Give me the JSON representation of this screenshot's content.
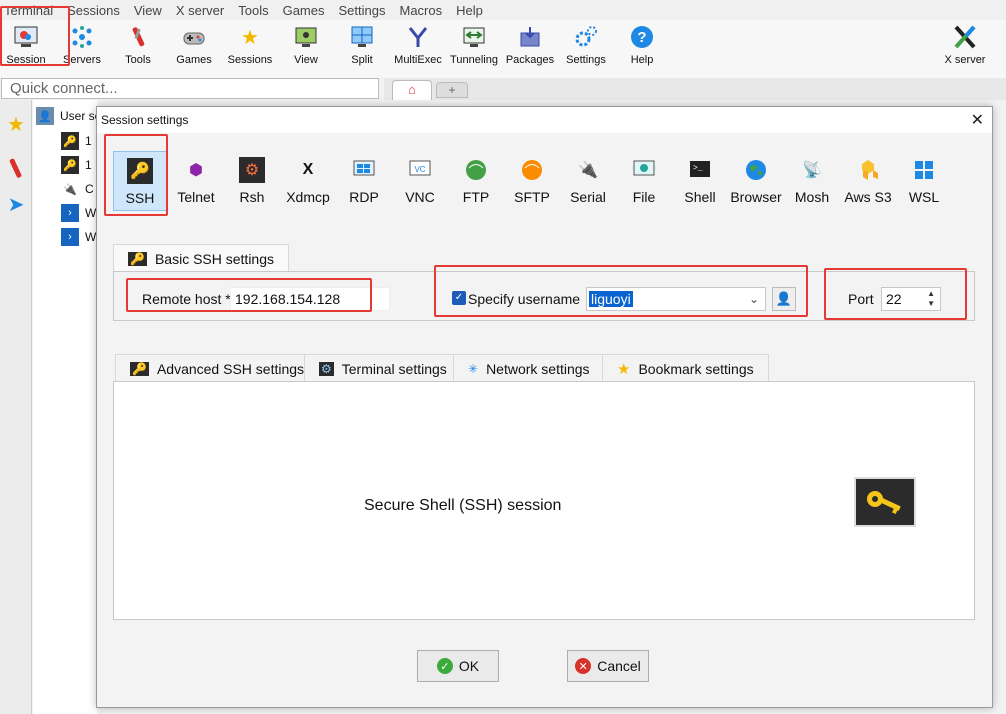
{
  "menu": [
    "Terminal",
    "Sessions",
    "View",
    "X server",
    "Tools",
    "Games",
    "Settings",
    "Macros",
    "Help"
  ],
  "toolbar": {
    "buttons": [
      {
        "label": "Session",
        "icon": "session-icon"
      },
      {
        "label": "Servers",
        "icon": "servers-icon"
      },
      {
        "label": "Tools",
        "icon": "tools-icon"
      },
      {
        "label": "Games",
        "icon": "games-icon"
      },
      {
        "label": "Sessions",
        "icon": "star-icon"
      },
      {
        "label": "View",
        "icon": "view-icon"
      },
      {
        "label": "Split",
        "icon": "split-icon"
      },
      {
        "label": "MultiExec",
        "icon": "multiexec-icon"
      },
      {
        "label": "Tunneling",
        "icon": "tunneling-icon"
      },
      {
        "label": "Packages",
        "icon": "packages-icon"
      },
      {
        "label": "Settings",
        "icon": "settings-icon"
      },
      {
        "label": "Help",
        "icon": "help-icon"
      }
    ],
    "xserver_label": "X server"
  },
  "quick_connect": {
    "placeholder": "Quick connect..."
  },
  "tree": {
    "root_label": "User se",
    "items": [
      "1",
      "1",
      "C",
      "W",
      "W"
    ]
  },
  "dialog": {
    "title": "Session settings",
    "session_types": [
      "SSH",
      "Telnet",
      "Rsh",
      "Xdmcp",
      "RDP",
      "VNC",
      "FTP",
      "SFTP",
      "Serial",
      "File",
      "Shell",
      "Browser",
      "Mosh",
      "Aws S3",
      "WSL"
    ],
    "selected_type": "SSH",
    "basic_tab_label": "Basic SSH settings",
    "remote_host_label": "Remote host *",
    "remote_host_value": "192.168.154.128",
    "specify_username_label": "Specify username",
    "specify_username_checked": true,
    "username_value": "liguoyi",
    "port_label": "Port",
    "port_value": "22",
    "lower_tabs": [
      "Advanced SSH settings",
      "Terminal settings",
      "Network settings",
      "Bookmark settings"
    ],
    "description": "Secure Shell (SSH) session",
    "ok_label": "OK",
    "cancel_label": "Cancel"
  },
  "colors": {
    "highlight_red": "#e53935",
    "selected_bg": "#cfe6fb",
    "ssh_key_bg": "#2b2b2b",
    "key_yellow": "#f5c518"
  }
}
